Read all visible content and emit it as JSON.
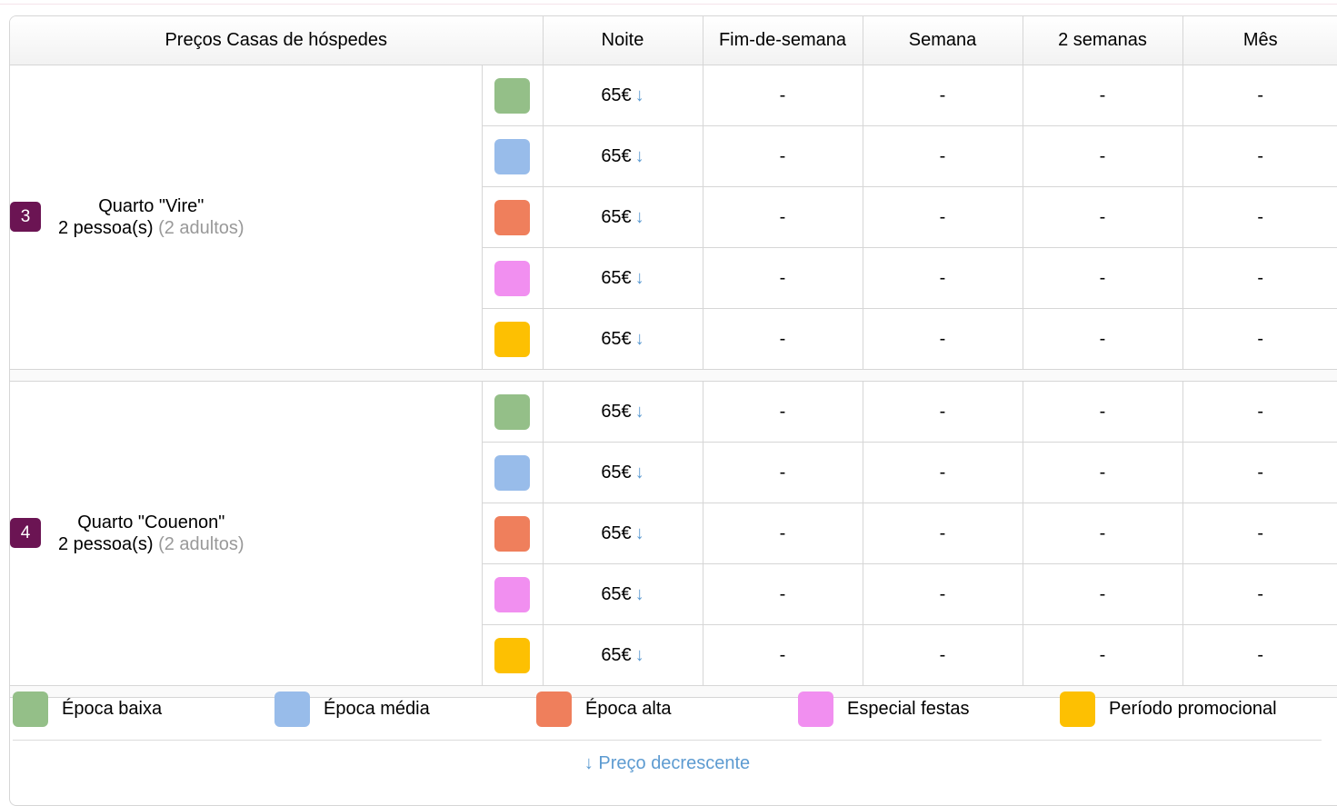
{
  "table": {
    "columns": [
      "Preços Casas de hóspedes",
      "Noite",
      "Fim-de-semana",
      "Semana",
      "2 semanas",
      "Mês"
    ],
    "price_arrow": "↓",
    "colors": {
      "room_badge": "#6b1453",
      "arrow": "#5d9bd1",
      "low": "#94bf88",
      "mid": "#98bcea",
      "high": "#ef7f5c",
      "holiday": "#f18ff0",
      "promo": "#fdc002"
    },
    "rooms": [
      {
        "number": "3",
        "name": "Quarto \"Vire\"",
        "capacity": "2 pessoa(s)",
        "capacity_detail": "(2 adultos)",
        "rates": [
          {
            "season": "low",
            "color": "#94bf88",
            "night": "65€",
            "weekend": "-",
            "week": "-",
            "two_weeks": "-",
            "month": "-"
          },
          {
            "season": "mid",
            "color": "#98bcea",
            "night": "65€",
            "weekend": "-",
            "week": "-",
            "two_weeks": "-",
            "month": "-"
          },
          {
            "season": "high",
            "color": "#ef7f5c",
            "night": "65€",
            "weekend": "-",
            "week": "-",
            "two_weeks": "-",
            "month": "-"
          },
          {
            "season": "holiday",
            "color": "#f18ff0",
            "night": "65€",
            "weekend": "-",
            "week": "-",
            "two_weeks": "-",
            "month": "-"
          },
          {
            "season": "promo",
            "color": "#fdc002",
            "night": "65€",
            "weekend": "-",
            "week": "-",
            "two_weeks": "-",
            "month": "-"
          }
        ]
      },
      {
        "number": "4",
        "name": "Quarto \"Couenon\"",
        "capacity": "2 pessoa(s)",
        "capacity_detail": "(2 adultos)",
        "rates": [
          {
            "season": "low",
            "color": "#94bf88",
            "night": "65€",
            "weekend": "-",
            "week": "-",
            "two_weeks": "-",
            "month": "-"
          },
          {
            "season": "mid",
            "color": "#98bcea",
            "night": "65€",
            "weekend": "-",
            "week": "-",
            "two_weeks": "-",
            "month": "-"
          },
          {
            "season": "high",
            "color": "#ef7f5c",
            "night": "65€",
            "weekend": "-",
            "week": "-",
            "two_weeks": "-",
            "month": "-"
          },
          {
            "season": "holiday",
            "color": "#f18ff0",
            "night": "65€",
            "weekend": "-",
            "week": "-",
            "two_weeks": "-",
            "month": "-"
          },
          {
            "season": "promo",
            "color": "#fdc002",
            "night": "65€",
            "weekend": "-",
            "week": "-",
            "two_weeks": "-",
            "month": "-"
          }
        ]
      }
    ]
  },
  "legend": {
    "items": [
      {
        "label": "Época baixa",
        "color": "#94bf88"
      },
      {
        "label": "Época média",
        "color": "#98bcea"
      },
      {
        "label": "Época alta",
        "color": "#ef7f5c"
      },
      {
        "label": "Especial festas",
        "color": "#f18ff0"
      },
      {
        "label": "Período promocional",
        "color": "#fdc002"
      }
    ],
    "note": "↓ Preço decrescente"
  }
}
